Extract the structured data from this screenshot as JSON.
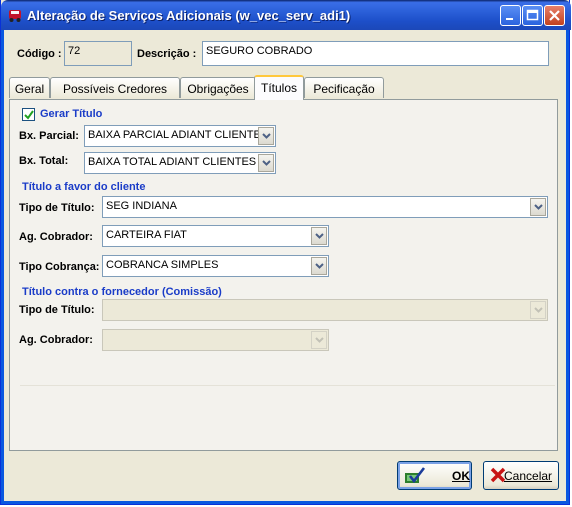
{
  "window": {
    "title": "Alteração de Serviços Adicionais (w_vec_serv_adi1)"
  },
  "header": {
    "codigo_label": "Código :",
    "codigo_value": "72",
    "descricao_label": "Descrição :",
    "descricao_value": "SEGURO COBRADO"
  },
  "tabs": [
    {
      "label": "Geral"
    },
    {
      "label": "Possíveis Credores"
    },
    {
      "label": "Obrigações"
    },
    {
      "label": "Títulos"
    },
    {
      "label": "Pecificação"
    }
  ],
  "active_tab": "Títulos",
  "titulos": {
    "gerar_titulo_label": "Gerar Título",
    "gerar_titulo_checked": true,
    "bx_parcial_label": "Bx. Parcial:",
    "bx_parcial_value": "BAIXA PARCIAL ADIANT CLIENTES",
    "bx_total_label": "Bx. Total:",
    "bx_total_value": "BAIXA TOTAL ADIANT CLIENTES",
    "cliente_section": "Título a favor do cliente",
    "tipo_titulo_label": "Tipo de Título:",
    "tipo_titulo_value": "SEG INDIANA",
    "ag_cobrador_label": "Ag. Cobrador:",
    "ag_cobrador_value": "CARTEIRA FIAT",
    "tipo_cobranca_label": "Tipo Cobrança:",
    "tipo_cobranca_value": "COBRANCA SIMPLES",
    "fornecedor_section": "Título contra o fornecedor (Comissão)",
    "forn_tipo_titulo_label": "Tipo de Título:",
    "forn_tipo_titulo_value": "",
    "forn_ag_cobrador_label": "Ag. Cobrador:",
    "forn_ag_cobrador_value": ""
  },
  "buttons": {
    "ok_label": "OK",
    "cancel_label": "Cancelar"
  },
  "colors": {
    "titlebar": "#2a5fd8",
    "section_text": "#1a3cc8",
    "active_tab_accent": "#ffc83c"
  }
}
